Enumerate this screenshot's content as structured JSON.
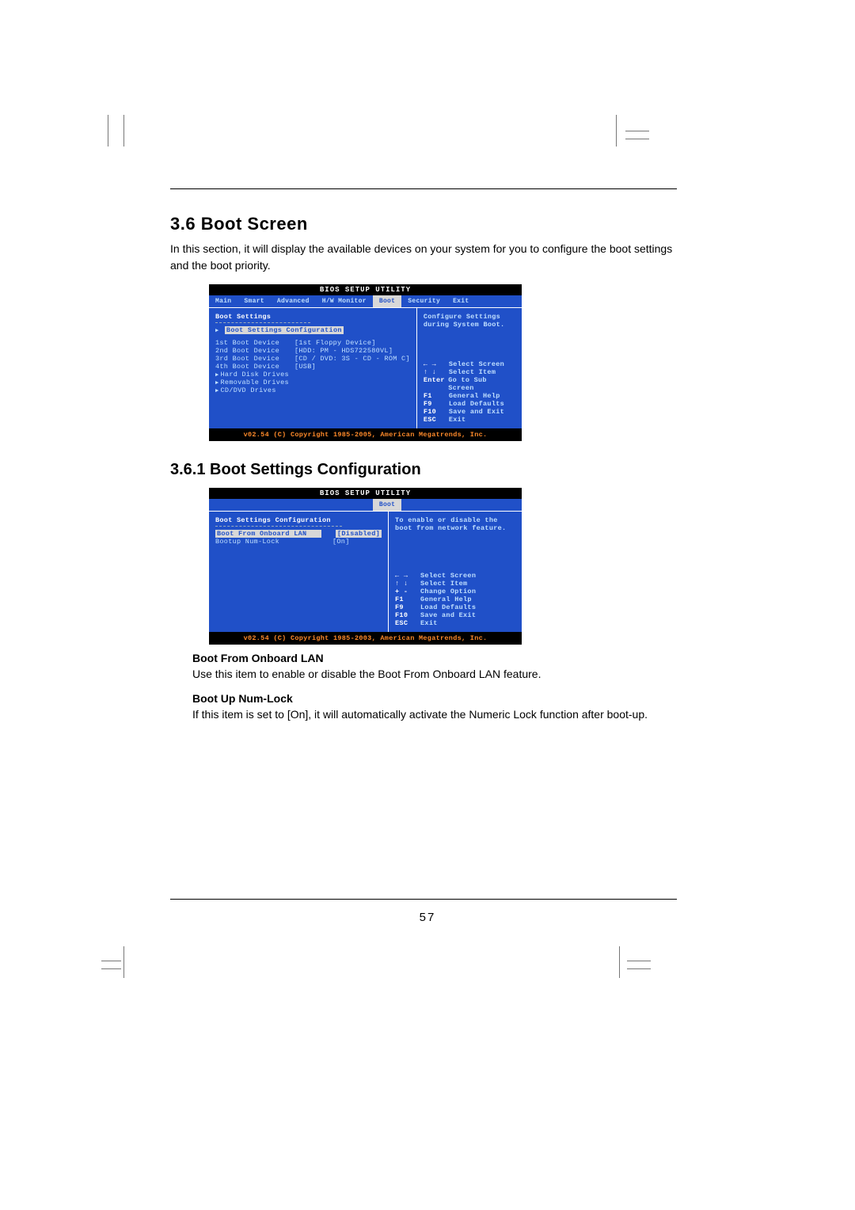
{
  "section": {
    "number_title": "3.6  Boot Screen",
    "intro": "In this section, it will display the available devices on your system for you to configure the boot settings and the boot priority."
  },
  "bios1": {
    "title": "BIOS  SETUP  UTILITY",
    "tabs": [
      "Main",
      "Smart",
      "Advanced",
      "H/W Monitor",
      "Boot",
      "Security",
      "Exit"
    ],
    "active_tab": "Boot",
    "left_title": "Boot Settings",
    "submenu": "Boot Settings Configuration",
    "rows": [
      {
        "k": "1st Boot Device",
        "v": "[1st  Floppy Device]"
      },
      {
        "k": "2nd Boot Device",
        "v": "[HDD: PM - HDS722580VL]"
      },
      {
        "k": "3rd Boot Device",
        "v": "[CD / DVD: 3S - CD - ROM C]"
      },
      {
        "k": "4th Boot Device",
        "v": "[USB]"
      }
    ],
    "extras": [
      "Hard Disk Drives",
      "Removable Drives",
      "CD/DVD Drives"
    ],
    "help_top": [
      "Configure Settings",
      "during System Boot."
    ],
    "keys": [
      {
        "kk": "← →",
        "kd": "Select Screen"
      },
      {
        "kk": "↑ ↓",
        "kd": "Select Item"
      },
      {
        "kk": "Enter",
        "kd": "Go to Sub Screen"
      },
      {
        "kk": "F1",
        "kd": "General Help"
      },
      {
        "kk": "F9",
        "kd": "Load Defaults"
      },
      {
        "kk": "F10",
        "kd": "Save and Exit"
      },
      {
        "kk": "ESC",
        "kd": "Exit"
      }
    ],
    "footer": "v02.54 (C) Copyright 1985-2005, American Megatrends, Inc."
  },
  "subsection": {
    "number_title": "3.6.1  Boot Settings Configuration"
  },
  "bios2": {
    "title": "BIOS  SETUP  UTILITY",
    "active_tab": "Boot",
    "left_title": "Boot Settings Configuration",
    "rows": [
      {
        "k": "Boot From Onboard LAN",
        "v": "[Disabled]",
        "hl": true
      },
      {
        "k": "Bootup Num-Lock",
        "v": "[On]",
        "hl": false
      }
    ],
    "help_top": [
      "To enable or disable the",
      "boot from network feature."
    ],
    "keys": [
      {
        "kk": "← →",
        "kd": "Select Screen"
      },
      {
        "kk": "↑ ↓",
        "kd": "Select Item"
      },
      {
        "kk": "+ -",
        "kd": "Change Option"
      },
      {
        "kk": "F1",
        "kd": "General Help"
      },
      {
        "kk": "F9",
        "kd": "Load Defaults"
      },
      {
        "kk": "F10",
        "kd": "Save and Exit"
      },
      {
        "kk": "ESC",
        "kd": "Exit"
      }
    ],
    "footer": "v02.54 (C) Copyright 1985-2003, American Megatrends, Inc."
  },
  "desc": {
    "h1": "Boot From Onboard LAN",
    "p1": "Use this item to enable or disable the Boot From Onboard LAN feature.",
    "h2": "Boot Up Num-Lock",
    "p2": "If this item is set to [On], it will automatically activate the Numeric Lock function after boot-up."
  },
  "page_number": "57"
}
